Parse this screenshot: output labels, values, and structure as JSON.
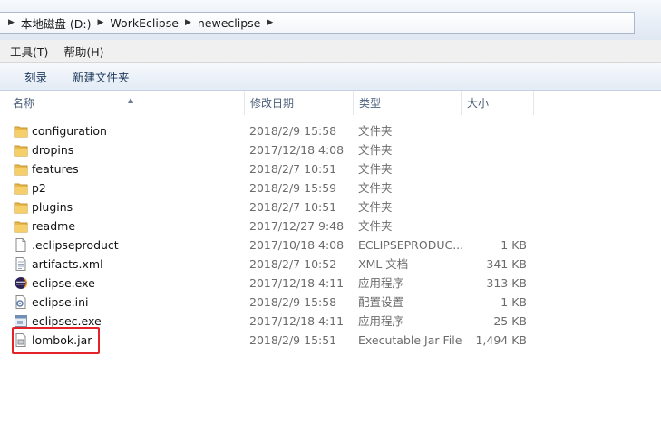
{
  "address": {
    "crumbs": [
      "本地磁盘 (D:)",
      "WorkEclipse",
      "neweclipse"
    ]
  },
  "menu": {
    "tools": "工具(T)",
    "help": "帮助(H)"
  },
  "toolbar": {
    "burn": "刻录",
    "new_folder": "新建文件夹"
  },
  "columns": {
    "name": "名称",
    "date": "修改日期",
    "type": "类型",
    "size": "大小"
  },
  "files": [
    {
      "name": "configuration",
      "date": "2018/2/9 15:58",
      "type": "文件夹",
      "size": "",
      "icon": "folder-icon"
    },
    {
      "name": "dropins",
      "date": "2017/12/18 4:08",
      "type": "文件夹",
      "size": "",
      "icon": "folder-icon"
    },
    {
      "name": "features",
      "date": "2018/2/7 10:51",
      "type": "文件夹",
      "size": "",
      "icon": "folder-icon"
    },
    {
      "name": "p2",
      "date": "2018/2/9 15:59",
      "type": "文件夹",
      "size": "",
      "icon": "folder-icon"
    },
    {
      "name": "plugins",
      "date": "2018/2/7 10:51",
      "type": "文件夹",
      "size": "",
      "icon": "folder-icon"
    },
    {
      "name": "readme",
      "date": "2017/12/27 9:48",
      "type": "文件夹",
      "size": "",
      "icon": "folder-icon"
    },
    {
      "name": ".eclipseproduct",
      "date": "2017/10/18 4:08",
      "type": "ECLIPSEPRODUC...",
      "size": "1 KB",
      "icon": "file-icon"
    },
    {
      "name": "artifacts.xml",
      "date": "2018/2/7 10:52",
      "type": "XML 文档",
      "size": "341 KB",
      "icon": "xml-file-icon"
    },
    {
      "name": "eclipse.exe",
      "date": "2017/12/18 4:11",
      "type": "应用程序",
      "size": "313 KB",
      "icon": "eclipse-icon"
    },
    {
      "name": "eclipse.ini",
      "date": "2018/2/9 15:58",
      "type": "配置设置",
      "size": "1 KB",
      "icon": "settings-file-icon"
    },
    {
      "name": "eclipsec.exe",
      "date": "2017/12/18 4:11",
      "type": "应用程序",
      "size": "25 KB",
      "icon": "exe-icon"
    },
    {
      "name": "lombok.jar",
      "date": "2018/2/9 15:51",
      "type": "Executable Jar File",
      "size": "1,494 KB",
      "icon": "jar-file-icon"
    }
  ],
  "colors": {
    "highlight": "#e5222a",
    "folder": "#e8b84a"
  }
}
